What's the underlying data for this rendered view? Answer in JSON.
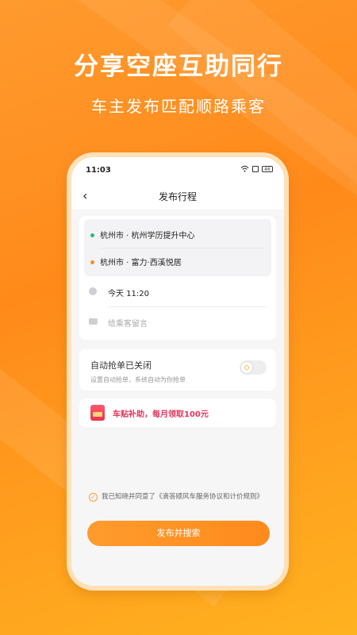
{
  "hero": {
    "title": "分享空座互助同行",
    "subtitle": "车主发布匹配顺路乘客"
  },
  "status_bar": {
    "time": "11:03",
    "battery": "46",
    "icons": [
      "wifi-icon",
      "signal-icon",
      "battery-icon"
    ]
  },
  "nav": {
    "back_icon": "chevron-left-icon",
    "title": "发布行程"
  },
  "route": {
    "origin": "杭州市 · 杭州学历提升中心",
    "destination": "杭州市 · 富力·西溪悦居"
  },
  "trip": {
    "time": "今天 11:20",
    "message_placeholder": "给乘客留言"
  },
  "auto_grab": {
    "title": "自动抢单已关闭",
    "description": "设置自动抢单，系统自动为你抢单",
    "enabled": false
  },
  "subsidy": {
    "text": "车贴补助，每月领取100元"
  },
  "agreement": {
    "text": "我已知晓并同意了《滴答顺风车服务协议和计价规则》",
    "checked": true
  },
  "submit": {
    "label": "发布并搜索"
  },
  "colors": {
    "accent": "#ff8b1f",
    "origin_dot": "#2eb872",
    "destination_dot": "#ff8b1f",
    "subsidy_text": "#e0365a"
  }
}
